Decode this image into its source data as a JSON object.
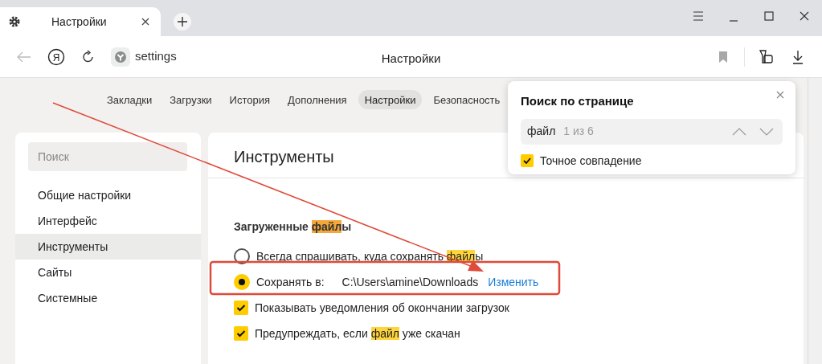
{
  "tabs": [
    {
      "label": "Настройки",
      "selected": true
    }
  ],
  "toolbar": {
    "logo_letter": "Я",
    "address": "settings",
    "page_title": "Настройки",
    "back_enabled": false
  },
  "nav": [
    {
      "label": "Закладки",
      "selected": false
    },
    {
      "label": "Загрузки",
      "selected": false
    },
    {
      "label": "История",
      "selected": false
    },
    {
      "label": "Дополнения",
      "selected": false
    },
    {
      "label": "Настройки",
      "selected": true
    },
    {
      "label": "Безопасность",
      "selected": false
    }
  ],
  "sidebar": {
    "search_placeholder": "Поиск",
    "items": [
      {
        "label": "Общие настройки",
        "selected": false
      },
      {
        "label": "Интерфейс",
        "selected": false
      },
      {
        "label": "Инструменты",
        "selected": true
      },
      {
        "label": "Сайты",
        "selected": false
      },
      {
        "label": "Системные",
        "selected": false
      }
    ]
  },
  "content": {
    "title": "Инструменты",
    "group_title": [
      {
        "text": "Загруженные "
      },
      {
        "text": "файл",
        "highlighted": true,
        "current_match": true
      },
      {
        "text": "ы"
      }
    ],
    "options": [
      {
        "kind": "radio",
        "checked": false,
        "segments": [
          {
            "text": "Всегда спрашивать, куда сохранять "
          },
          {
            "text": "файл",
            "highlighted": true,
            "current_match": false
          },
          {
            "text": "ы"
          }
        ]
      },
      {
        "kind": "radio",
        "checked": true,
        "segments": [
          {
            "text": "Сохранять в:"
          }
        ],
        "path": "C:\\Users\\amine\\Downloads",
        "link": "Изменить"
      },
      {
        "kind": "checkbox",
        "checked": true,
        "segments": [
          {
            "text": "Показывать уведомления об окончании загрузок"
          }
        ]
      },
      {
        "kind": "checkbox",
        "checked": true,
        "segments": [
          {
            "text": "Предупреждать, если "
          },
          {
            "text": "файл",
            "highlighted": true,
            "current_match": false
          },
          {
            "text": " уже скачан"
          }
        ]
      }
    ]
  },
  "find_bar": {
    "title": "Поиск по странице",
    "query": "файл",
    "count": "1 из 6",
    "exact_match": {
      "label": "Точное совпадение",
      "checked": true
    }
  }
}
